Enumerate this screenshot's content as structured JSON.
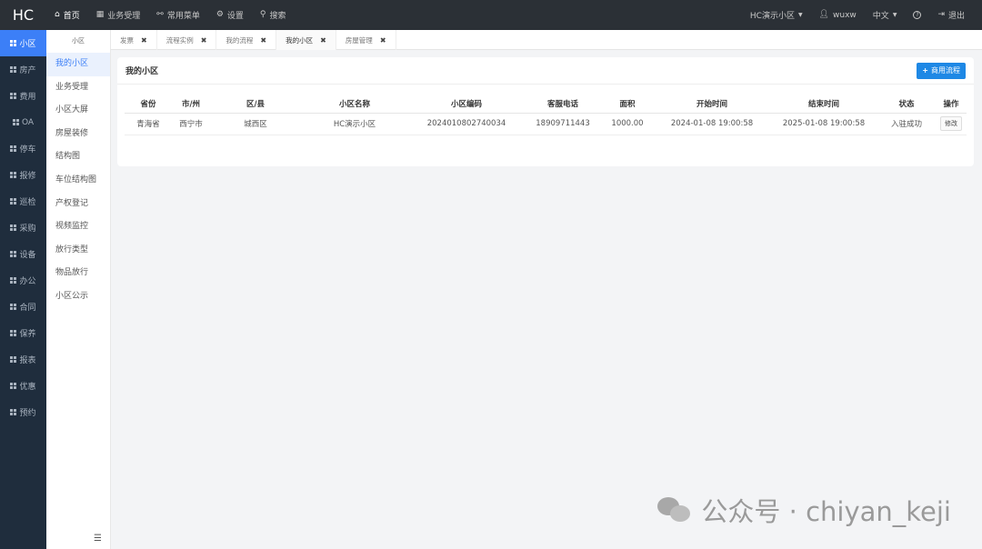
{
  "brand": "HC",
  "topnav": [
    {
      "icon": "home-icon",
      "label": "首页",
      "glyph": "⌂"
    },
    {
      "icon": "calculator-icon",
      "label": "业务受理",
      "glyph": "▦"
    },
    {
      "icon": "sitemap-icon",
      "label": "常用菜单",
      "glyph": "⚯"
    },
    {
      "icon": "gear-icon",
      "label": "设置",
      "glyph": "⚙"
    },
    {
      "icon": "search-icon",
      "label": "搜索",
      "glyph": "⚲"
    }
  ],
  "topright": {
    "community": "HC演示小区",
    "user": "wuxw",
    "language": "中文",
    "help_glyph": "?",
    "logout": "退出"
  },
  "leftbar": [
    {
      "label": "小区"
    },
    {
      "label": "房产"
    },
    {
      "label": "费用"
    },
    {
      "label": "OA"
    },
    {
      "label": "停车"
    },
    {
      "label": "报修"
    },
    {
      "label": "巡检"
    },
    {
      "label": "采购"
    },
    {
      "label": "设备"
    },
    {
      "label": "办公"
    },
    {
      "label": "合同"
    },
    {
      "label": "保养"
    },
    {
      "label": "报表"
    },
    {
      "label": "优惠"
    },
    {
      "label": "预约"
    }
  ],
  "submenu": {
    "title": "小区",
    "items": [
      "我的小区",
      "业务受理",
      "小区大屏",
      "房屋装修",
      "结构图",
      "车位结构图",
      "产权登记",
      "视频监控",
      "放行类型",
      "物品放行",
      "小区公示"
    ]
  },
  "tabs": [
    "发票",
    "流程实例",
    "我的流程",
    "我的小区",
    "房屋管理"
  ],
  "card": {
    "title": "我的小区",
    "action_label": "商用流程"
  },
  "table": {
    "headers": [
      "省份",
      "市/州",
      "区/县",
      "小区名称",
      "小区编码",
      "客服电话",
      "面积",
      "开始时间",
      "结束时间",
      "状态",
      "操作"
    ],
    "rows": [
      {
        "province": "青海省",
        "city": "西宁市",
        "district": "城西区",
        "name": "HC演示小区",
        "code": "2024010802740034",
        "phone": "18909711443",
        "area": "1000.00",
        "start": "2024-01-08 19:00:58",
        "end": "2025-01-08 19:00:58",
        "status": "入驻成功",
        "action": "修改"
      }
    ]
  },
  "watermark": "公众号 · chiyan_keji"
}
